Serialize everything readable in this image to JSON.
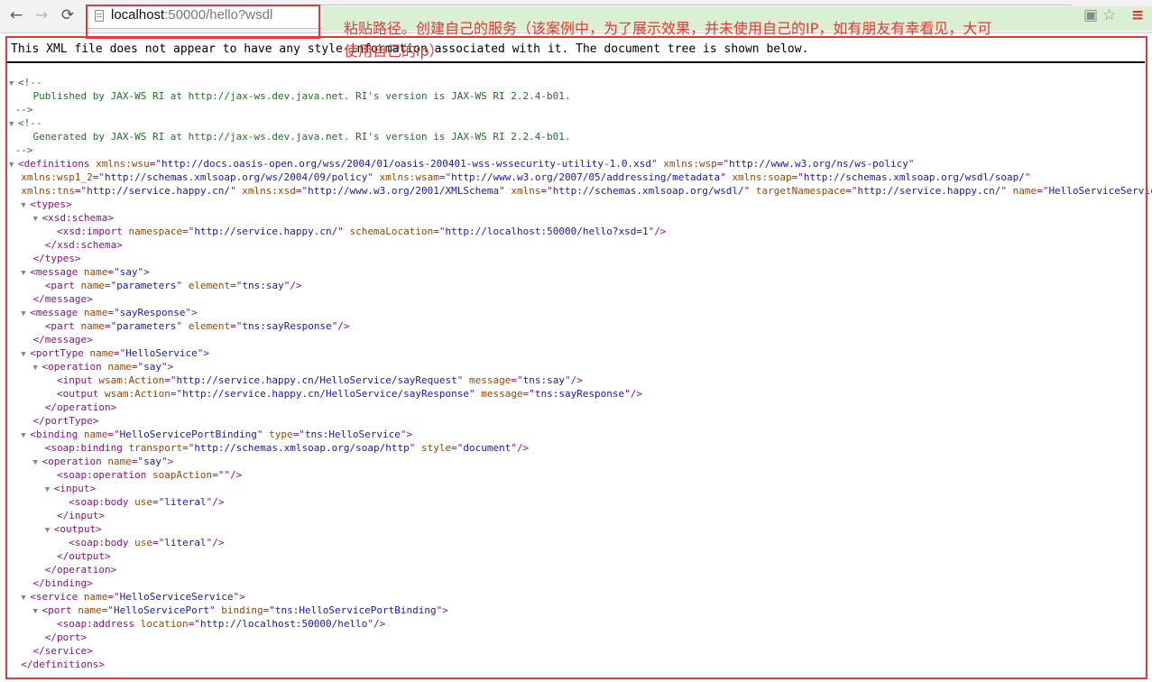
{
  "toolbar": {
    "back_icon": "←",
    "forward_icon": "→",
    "reload_icon": "⟳",
    "url_host": "localhost",
    "url_path": ":50000/hello?wsdl",
    "translate_icon": "▣",
    "star_icon": "☆",
    "menu_icon": "≡"
  },
  "annotation": {
    "line1": "粘贴路径。创建自己的服务（该案例中，为了展示效果，并未使用自己的IP，如有朋友有幸看见，大可",
    "line2": "使用自己的ip）"
  },
  "viewer": {
    "notice": "This XML file does not appear to have any style information associated with it. The document tree is shown below."
  },
  "xml": [
    [
      [
        "tri",
        "▼"
      ],
      [
        "cm",
        "<!--"
      ]
    ],
    [
      [
        "cm",
        "    Published by JAX-WS RI at http://jax-ws.dev.java.net. RI's version is JAX-WS RI 2.2.4-b01."
      ]
    ],
    [
      [
        "cm",
        " -->"
      ]
    ],
    [
      [
        "tri",
        "▼"
      ],
      [
        "cm",
        "<!--"
      ]
    ],
    [
      [
        "cm",
        "    Generated by JAX-WS RI at http://jax-ws.dev.java.net. RI's version is JAX-WS RI 2.2.4-b01."
      ]
    ],
    [
      [
        "cm",
        " -->"
      ]
    ],
    [
      [
        "tri",
        "▼"
      ],
      [
        "tg",
        "<definitions"
      ],
      [
        "at",
        " xmlns:wsu"
      ],
      [
        "tg",
        "=\""
      ],
      [
        "av",
        "http://docs.oasis-open.org/wss/2004/01/oasis-200401-wss-wssecurity-utility-1.0.xsd"
      ],
      [
        "tg",
        "\""
      ],
      [
        "at",
        " xmlns:wsp"
      ],
      [
        "tg",
        "=\""
      ],
      [
        "av",
        "http://www.w3.org/ns/ws-policy"
      ],
      [
        "tg",
        "\""
      ]
    ],
    [
      [
        "at",
        "  xmlns:wsp1_2"
      ],
      [
        "tg",
        "=\""
      ],
      [
        "av",
        "http://schemas.xmlsoap.org/ws/2004/09/policy"
      ],
      [
        "tg",
        "\""
      ],
      [
        "at",
        " xmlns:wsam"
      ],
      [
        "tg",
        "=\""
      ],
      [
        "av",
        "http://www.w3.org/2007/05/addressing/metadata"
      ],
      [
        "tg",
        "\""
      ],
      [
        "at",
        " xmlns:soap"
      ],
      [
        "tg",
        "=\""
      ],
      [
        "av",
        "http://schemas.xmlsoap.org/wsdl/soap/"
      ],
      [
        "tg",
        "\""
      ]
    ],
    [
      [
        "at",
        "  xmlns:tns"
      ],
      [
        "tg",
        "=\""
      ],
      [
        "av",
        "http://service.happy.cn/"
      ],
      [
        "tg",
        "\""
      ],
      [
        "at",
        " xmlns:xsd"
      ],
      [
        "tg",
        "=\""
      ],
      [
        "av",
        "http://www.w3.org/2001/XMLSchema"
      ],
      [
        "tg",
        "\""
      ],
      [
        "at",
        " xmlns"
      ],
      [
        "tg",
        "=\""
      ],
      [
        "av",
        "http://schemas.xmlsoap.org/wsdl/"
      ],
      [
        "tg",
        "\""
      ],
      [
        "at",
        " targetNamespace"
      ],
      [
        "tg",
        "=\""
      ],
      [
        "av",
        "http://service.happy.cn/"
      ],
      [
        "tg",
        "\""
      ],
      [
        "at",
        " name"
      ],
      [
        "tg",
        "=\""
      ],
      [
        "av",
        "HelloServiceService"
      ],
      [
        "tg",
        "\">"
      ]
    ],
    [
      [
        "sp",
        "  "
      ],
      [
        "tri",
        "▼"
      ],
      [
        "tg",
        "<types>"
      ]
    ],
    [
      [
        "sp",
        "    "
      ],
      [
        "tri",
        "▼"
      ],
      [
        "tg",
        "<xsd:schema>"
      ]
    ],
    [
      [
        "sp",
        "        "
      ],
      [
        "tg",
        "<xsd:import"
      ],
      [
        "at",
        " namespace"
      ],
      [
        "tg",
        "=\""
      ],
      [
        "av",
        "http://service.happy.cn/"
      ],
      [
        "tg",
        "\""
      ],
      [
        "at",
        " schemaLocation"
      ],
      [
        "tg",
        "=\""
      ],
      [
        "av",
        "http://localhost:50000/hello?xsd=1"
      ],
      [
        "tg",
        "\"/>"
      ]
    ],
    [
      [
        "sp",
        "      "
      ],
      [
        "tg",
        "</xsd:schema>"
      ]
    ],
    [
      [
        "sp",
        "    "
      ],
      [
        "tg",
        "</types>"
      ]
    ],
    [
      [
        "sp",
        "  "
      ],
      [
        "tri",
        "▼"
      ],
      [
        "tg",
        "<message"
      ],
      [
        "at",
        " name"
      ],
      [
        "tg",
        "=\""
      ],
      [
        "av",
        "say"
      ],
      [
        "tg",
        "\">"
      ]
    ],
    [
      [
        "sp",
        "      "
      ],
      [
        "tg",
        "<part"
      ],
      [
        "at",
        " name"
      ],
      [
        "tg",
        "=\""
      ],
      [
        "av",
        "parameters"
      ],
      [
        "tg",
        "\""
      ],
      [
        "at",
        " element"
      ],
      [
        "tg",
        "=\""
      ],
      [
        "av",
        "tns:say"
      ],
      [
        "tg",
        "\"/>"
      ]
    ],
    [
      [
        "sp",
        "    "
      ],
      [
        "tg",
        "</message>"
      ]
    ],
    [
      [
        "sp",
        "  "
      ],
      [
        "tri",
        "▼"
      ],
      [
        "tg",
        "<message"
      ],
      [
        "at",
        " name"
      ],
      [
        "tg",
        "=\""
      ],
      [
        "av",
        "sayResponse"
      ],
      [
        "tg",
        "\">"
      ]
    ],
    [
      [
        "sp",
        "      "
      ],
      [
        "tg",
        "<part"
      ],
      [
        "at",
        " name"
      ],
      [
        "tg",
        "=\""
      ],
      [
        "av",
        "parameters"
      ],
      [
        "tg",
        "\""
      ],
      [
        "at",
        " element"
      ],
      [
        "tg",
        "=\""
      ],
      [
        "av",
        "tns:sayResponse"
      ],
      [
        "tg",
        "\"/>"
      ]
    ],
    [
      [
        "sp",
        "    "
      ],
      [
        "tg",
        "</message>"
      ]
    ],
    [
      [
        "sp",
        "  "
      ],
      [
        "tri",
        "▼"
      ],
      [
        "tg",
        "<portType"
      ],
      [
        "at",
        " name"
      ],
      [
        "tg",
        "=\""
      ],
      [
        "av",
        "HelloService"
      ],
      [
        "tg",
        "\">"
      ]
    ],
    [
      [
        "sp",
        "    "
      ],
      [
        "tri",
        "▼"
      ],
      [
        "tg",
        "<operation"
      ],
      [
        "at",
        " name"
      ],
      [
        "tg",
        "=\""
      ],
      [
        "av",
        "say"
      ],
      [
        "tg",
        "\">"
      ]
    ],
    [
      [
        "sp",
        "        "
      ],
      [
        "tg",
        "<input"
      ],
      [
        "at",
        " wsam:Action"
      ],
      [
        "tg",
        "=\""
      ],
      [
        "av",
        "http://service.happy.cn/HelloService/sayRequest"
      ],
      [
        "tg",
        "\""
      ],
      [
        "at",
        " message"
      ],
      [
        "tg",
        "=\""
      ],
      [
        "av",
        "tns:say"
      ],
      [
        "tg",
        "\"/>"
      ]
    ],
    [
      [
        "sp",
        "        "
      ],
      [
        "tg",
        "<output"
      ],
      [
        "at",
        " wsam:Action"
      ],
      [
        "tg",
        "=\""
      ],
      [
        "av",
        "http://service.happy.cn/HelloService/sayResponse"
      ],
      [
        "tg",
        "\""
      ],
      [
        "at",
        " message"
      ],
      [
        "tg",
        "=\""
      ],
      [
        "av",
        "tns:sayResponse"
      ],
      [
        "tg",
        "\"/>"
      ]
    ],
    [
      [
        "sp",
        "      "
      ],
      [
        "tg",
        "</operation>"
      ]
    ],
    [
      [
        "sp",
        "    "
      ],
      [
        "tg",
        "</portType>"
      ]
    ],
    [
      [
        "sp",
        "  "
      ],
      [
        "tri",
        "▼"
      ],
      [
        "tg",
        "<binding"
      ],
      [
        "at",
        " name"
      ],
      [
        "tg",
        "=\""
      ],
      [
        "av",
        "HelloServicePortBinding"
      ],
      [
        "tg",
        "\""
      ],
      [
        "at",
        " type"
      ],
      [
        "tg",
        "=\""
      ],
      [
        "av",
        "tns:HelloService"
      ],
      [
        "tg",
        "\">"
      ]
    ],
    [
      [
        "sp",
        "      "
      ],
      [
        "tg",
        "<soap:binding"
      ],
      [
        "at",
        " transport"
      ],
      [
        "tg",
        "=\""
      ],
      [
        "av",
        "http://schemas.xmlsoap.org/soap/http"
      ],
      [
        "tg",
        "\""
      ],
      [
        "at",
        " style"
      ],
      [
        "tg",
        "=\""
      ],
      [
        "av",
        "document"
      ],
      [
        "tg",
        "\"/>"
      ]
    ],
    [
      [
        "sp",
        "    "
      ],
      [
        "tri",
        "▼"
      ],
      [
        "tg",
        "<operation"
      ],
      [
        "at",
        " name"
      ],
      [
        "tg",
        "=\""
      ],
      [
        "av",
        "say"
      ],
      [
        "tg",
        "\">"
      ]
    ],
    [
      [
        "sp",
        "        "
      ],
      [
        "tg",
        "<soap:operation"
      ],
      [
        "at",
        " soapAction"
      ],
      [
        "tg",
        "=\""
      ],
      [
        "av",
        ""
      ],
      [
        "tg",
        "\"/>"
      ]
    ],
    [
      [
        "sp",
        "      "
      ],
      [
        "tri",
        "▼"
      ],
      [
        "tg",
        "<input>"
      ]
    ],
    [
      [
        "sp",
        "          "
      ],
      [
        "tg",
        "<soap:body"
      ],
      [
        "at",
        " use"
      ],
      [
        "tg",
        "=\""
      ],
      [
        "av",
        "literal"
      ],
      [
        "tg",
        "\"/>"
      ]
    ],
    [
      [
        "sp",
        "        "
      ],
      [
        "tg",
        "</input>"
      ]
    ],
    [
      [
        "sp",
        "      "
      ],
      [
        "tri",
        "▼"
      ],
      [
        "tg",
        "<output>"
      ]
    ],
    [
      [
        "sp",
        "          "
      ],
      [
        "tg",
        "<soap:body"
      ],
      [
        "at",
        " use"
      ],
      [
        "tg",
        "=\""
      ],
      [
        "av",
        "literal"
      ],
      [
        "tg",
        "\"/>"
      ]
    ],
    [
      [
        "sp",
        "        "
      ],
      [
        "tg",
        "</output>"
      ]
    ],
    [
      [
        "sp",
        "      "
      ],
      [
        "tg",
        "</operation>"
      ]
    ],
    [
      [
        "sp",
        "    "
      ],
      [
        "tg",
        "</binding>"
      ]
    ],
    [
      [
        "sp",
        "  "
      ],
      [
        "tri",
        "▼"
      ],
      [
        "tg",
        "<service"
      ],
      [
        "at",
        " name"
      ],
      [
        "tg",
        "=\""
      ],
      [
        "av",
        "HelloServiceService"
      ],
      [
        "tg",
        "\">"
      ]
    ],
    [
      [
        "sp",
        "    "
      ],
      [
        "tri",
        "▼"
      ],
      [
        "tg",
        "<port"
      ],
      [
        "at",
        " name"
      ],
      [
        "tg",
        "=\""
      ],
      [
        "av",
        "HelloServicePort"
      ],
      [
        "tg",
        "\""
      ],
      [
        "at",
        " binding"
      ],
      [
        "tg",
        "=\""
      ],
      [
        "av",
        "tns:HelloServicePortBinding"
      ],
      [
        "tg",
        "\">"
      ]
    ],
    [
      [
        "sp",
        "        "
      ],
      [
        "tg",
        "<soap:address"
      ],
      [
        "at",
        " location"
      ],
      [
        "tg",
        "=\""
      ],
      [
        "av",
        "http://localhost:50000/hello"
      ],
      [
        "tg",
        "\"/>"
      ]
    ],
    [
      [
        "sp",
        "      "
      ],
      [
        "tg",
        "</port>"
      ]
    ],
    [
      [
        "sp",
        "    "
      ],
      [
        "tg",
        "</service>"
      ]
    ],
    [
      [
        "sp",
        "  "
      ],
      [
        "tg",
        "</definitions>"
      ]
    ]
  ]
}
